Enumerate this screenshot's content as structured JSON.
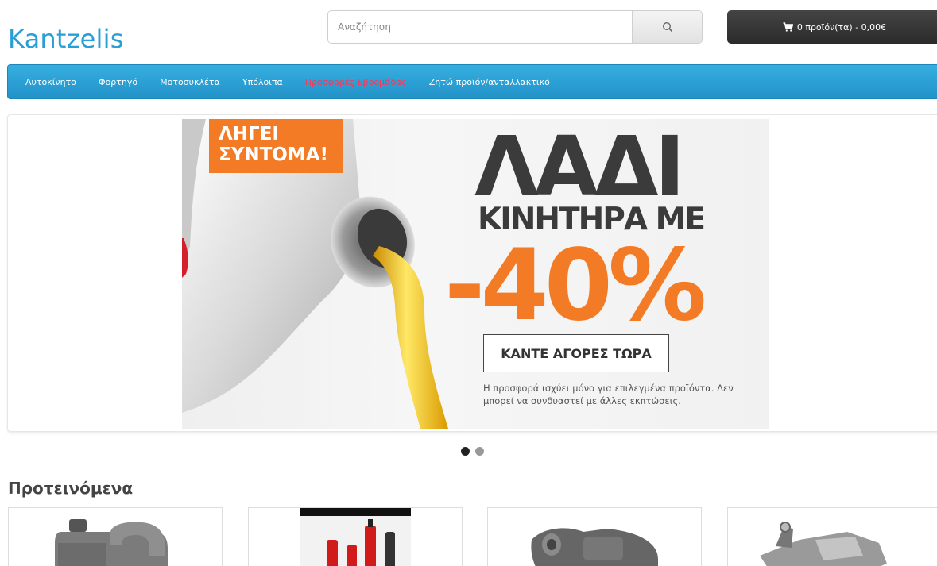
{
  "header": {
    "logo": "Kantzelis",
    "search": {
      "placeholder": "Αναζήτηση",
      "icon": "search-icon"
    },
    "cart": {
      "label": "0 προϊόν(τα) - 0,00€",
      "icon": "cart-icon"
    }
  },
  "nav": {
    "items": [
      {
        "label": "Αυτοκίνητο"
      },
      {
        "label": "Φορτηγό"
      },
      {
        "label": "Μοτοσυκλέτα"
      },
      {
        "label": "Υπόλοιπα"
      },
      {
        "label": "Προσφορές Εβδομάδας"
      },
      {
        "label": "Ζητώ προϊόν/ανταλλακτικό"
      }
    ],
    "highlight_color": "#ff3355"
  },
  "slider": {
    "badge": "ΛΗΓΕΙ ΣΥΝΤΟΜΑ!",
    "headline": "ΛΑΔΙ",
    "subhead": "ΚΙΝΗΤΗΡΑ ΜΕ",
    "discount": "-40%",
    "cta": "ΚΑΝΤΕ ΑΓΟΡΕΣ ΤΩΡΑ",
    "disclaimer": "Η προσφορά ισχύει μόνο για επιλεγμένα προϊόντα. Δεν μπορεί να συνδυαστεί με άλλες εκπτώσεις.",
    "slide_count": 2,
    "active_slide": 1,
    "accent_color": "#f47b25"
  },
  "featured": {
    "title": "Προτεινόμενα"
  },
  "colors": {
    "brand": "#2a9fd6",
    "navbar": "#2a9fd6",
    "cart_bg": "#333333"
  }
}
